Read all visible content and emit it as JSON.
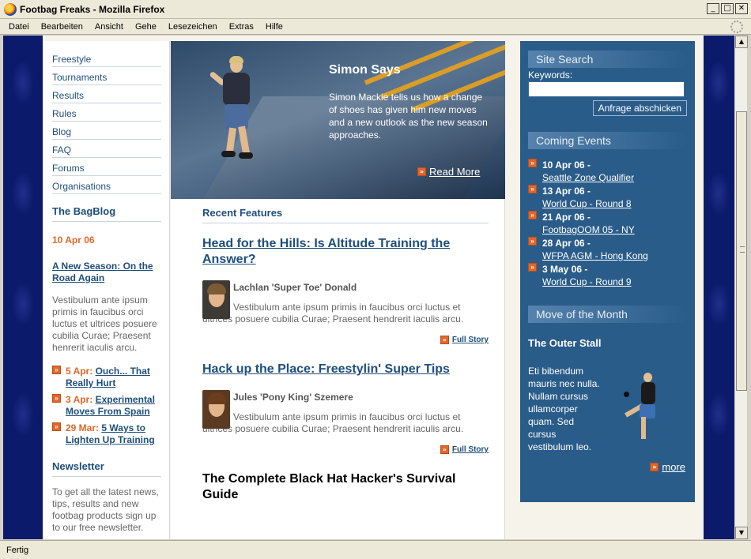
{
  "window": {
    "title": "Footbag Freaks - Mozilla Firefox",
    "min_glyph": "_",
    "max_glyph": "□",
    "close_glyph": "✕"
  },
  "menubar": [
    "Datei",
    "Bearbeiten",
    "Ansicht",
    "Gehe",
    "Lesezeichen",
    "Extras",
    "Hilfe"
  ],
  "nav": [
    "Freestyle",
    "Tournaments",
    "Results",
    "Rules",
    "Blog",
    "FAQ",
    "Forums",
    "Organisations"
  ],
  "bagblog": {
    "heading": "The BagBlog",
    "date": "10 Apr 06",
    "post_title": "A New Season: On the Road Again",
    "post_text": "Vestibulum ante ipsum primis in faucibus orci luctus et ultrices posuere cubilia Curae; Praesent henrerit iaculis arcu.",
    "items": [
      {
        "date": "5 Apr:",
        "title": "Ouch... That Really Hurt"
      },
      {
        "date": "3 Apr:",
        "title": "Experimental Moves From Spain"
      },
      {
        "date": "29 Mar:",
        "title": "5 Ways to Lighten Up Training"
      }
    ]
  },
  "newsletter": {
    "heading": "Newsletter",
    "text": "To get all the latest news, tips, results and new footbag products sign up to our free newsletter."
  },
  "hero": {
    "title": "Simon Says",
    "text": "Simon Mackie tells us how a change of shoes has given him new moves and a new outlook as the new season approaches.",
    "more": "Read More"
  },
  "features": {
    "heading": "Recent Features",
    "articles": [
      {
        "title": "Head for the Hills: Is Altitude Training the Answer?",
        "author": "Lachlan 'Super Toe' Donald",
        "text": "Vestibulum ante ipsum primis in faucibus orci luctus et ultrices posuere cubilia Curae; Praesent hendrerit iaculis arcu.",
        "more": "Full Story"
      },
      {
        "title": "Hack up the Place: Freestylin' Super Tips",
        "author": "Jules 'Pony King' Szemere",
        "text": "Vestibulum ante ipsum primis in faucibus orci luctus et ultrices posuere cubilia Curae; Praesent hendrerit iaculis arcu.",
        "more": "Full Story"
      },
      {
        "title": "The Complete Black Hat Hacker's Survival Guide"
      }
    ]
  },
  "search": {
    "heading": "Site Search",
    "label": "Keywords:",
    "value": "",
    "button": "Anfrage abschicken"
  },
  "events": {
    "heading": "Coming Events",
    "items": [
      {
        "date": "10 Apr 06 -",
        "title": "Seattle Zone Qualifier"
      },
      {
        "date": "13 Apr 06 -",
        "title": "World Cup - Round 8"
      },
      {
        "date": "21 Apr 06 -",
        "title": "FootbagOOM 05 - NY"
      },
      {
        "date": "28 Apr 06 -",
        "title": "WFPA AGM - Hong Kong"
      },
      {
        "date": "3 May 06 -",
        "title": "World Cup - Round 9"
      }
    ]
  },
  "move": {
    "heading": "Move of the Month",
    "title": "The Outer Stall",
    "text": "Eti bibendum mauris nec nulla. Nullam cursus ullamcorper quam. Sed cursus vestibulum leo.",
    "more": "more"
  },
  "scrollbar": {
    "up_glyph": "▲",
    "down_glyph": "▼"
  },
  "statusbar": {
    "text": "Fertig"
  },
  "colors": {
    "link_blue": "#1f4e7a",
    "accent_orange": "#e2672a",
    "sidebar_blue": "#2a5c8a",
    "page_background": "#0c1a6b"
  }
}
